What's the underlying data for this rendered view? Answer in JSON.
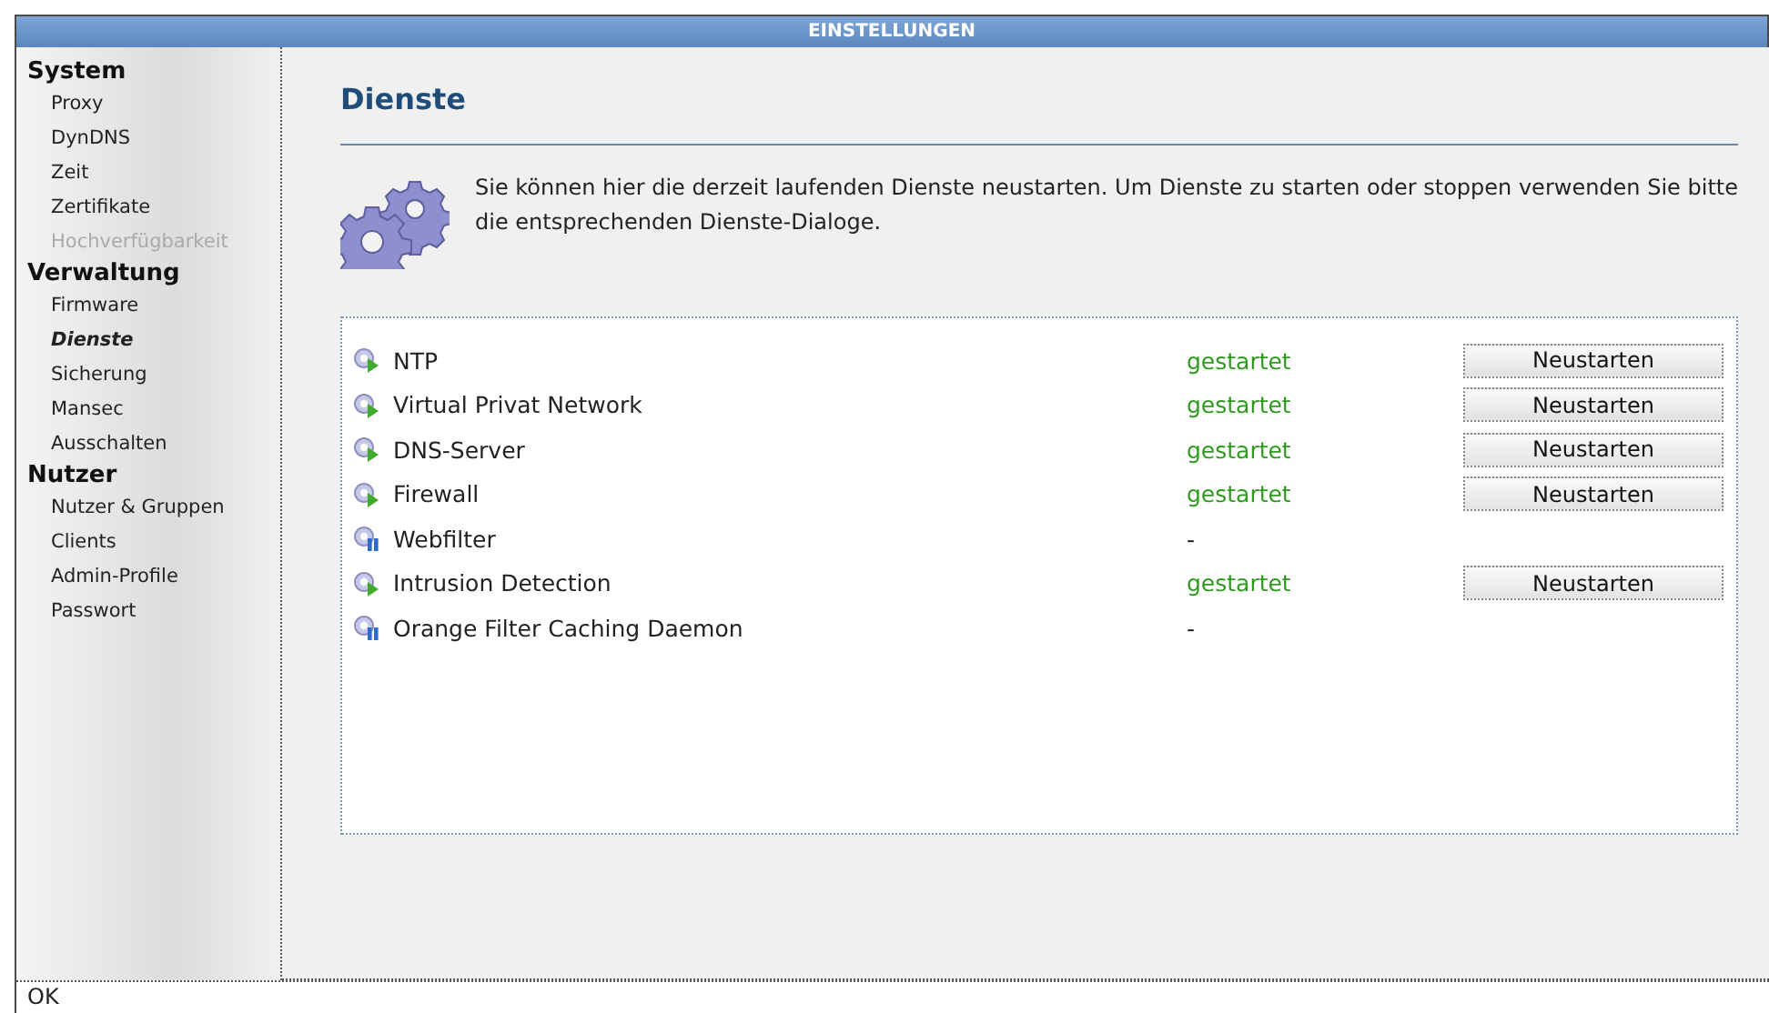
{
  "window": {
    "title": "EINSTELLUNGEN"
  },
  "sidebar": {
    "sections": [
      {
        "title": "System",
        "items": [
          {
            "label": "Proxy",
            "selected": false,
            "disabled": false
          },
          {
            "label": "DynDNS",
            "selected": false,
            "disabled": false
          },
          {
            "label": "Zeit",
            "selected": false,
            "disabled": false
          },
          {
            "label": "Zertifikate",
            "selected": false,
            "disabled": false
          },
          {
            "label": "Hochverfügbarkeit",
            "selected": false,
            "disabled": true
          }
        ]
      },
      {
        "title": "Verwaltung",
        "items": [
          {
            "label": "Firmware",
            "selected": false,
            "disabled": false
          },
          {
            "label": "Dienste",
            "selected": true,
            "disabled": false
          },
          {
            "label": "Sicherung",
            "selected": false,
            "disabled": false
          },
          {
            "label": "Mansec",
            "selected": false,
            "disabled": false
          },
          {
            "label": "Ausschalten",
            "selected": false,
            "disabled": false
          }
        ]
      },
      {
        "title": "Nutzer",
        "items": [
          {
            "label": "Nutzer & Gruppen",
            "selected": false,
            "disabled": false
          },
          {
            "label": "Clients",
            "selected": false,
            "disabled": false
          },
          {
            "label": "Admin-Profile",
            "selected": false,
            "disabled": false
          },
          {
            "label": "Passwort",
            "selected": false,
            "disabled": false
          }
        ]
      }
    ]
  },
  "page": {
    "heading": "Dienste",
    "description": "Sie können hier die derzeit laufenden Dienste neustarten. Um Dienste zu starten oder stoppen verwenden Sie bitte die entsprechenden Dienste-Dialoge."
  },
  "services": [
    {
      "name": "NTP",
      "kind": "running",
      "status": "gestartet",
      "button": "Neustarten"
    },
    {
      "name": "Virtual Privat Network",
      "kind": "running",
      "status": "gestartet",
      "button": "Neustarten"
    },
    {
      "name": "DNS-Server",
      "kind": "running",
      "status": "gestartet",
      "button": "Neustarten"
    },
    {
      "name": "Firewall",
      "kind": "running",
      "status": "gestartet",
      "button": "Neustarten"
    },
    {
      "name": "Webfilter",
      "kind": "stopped",
      "status": "-"
    },
    {
      "name": "Intrusion Detection",
      "kind": "running",
      "status": "gestartet",
      "button": "Neustarten"
    },
    {
      "name": "Orange Filter Caching Daemon",
      "kind": "stopped",
      "status": "-"
    }
  ],
  "status_bar": "OK"
}
